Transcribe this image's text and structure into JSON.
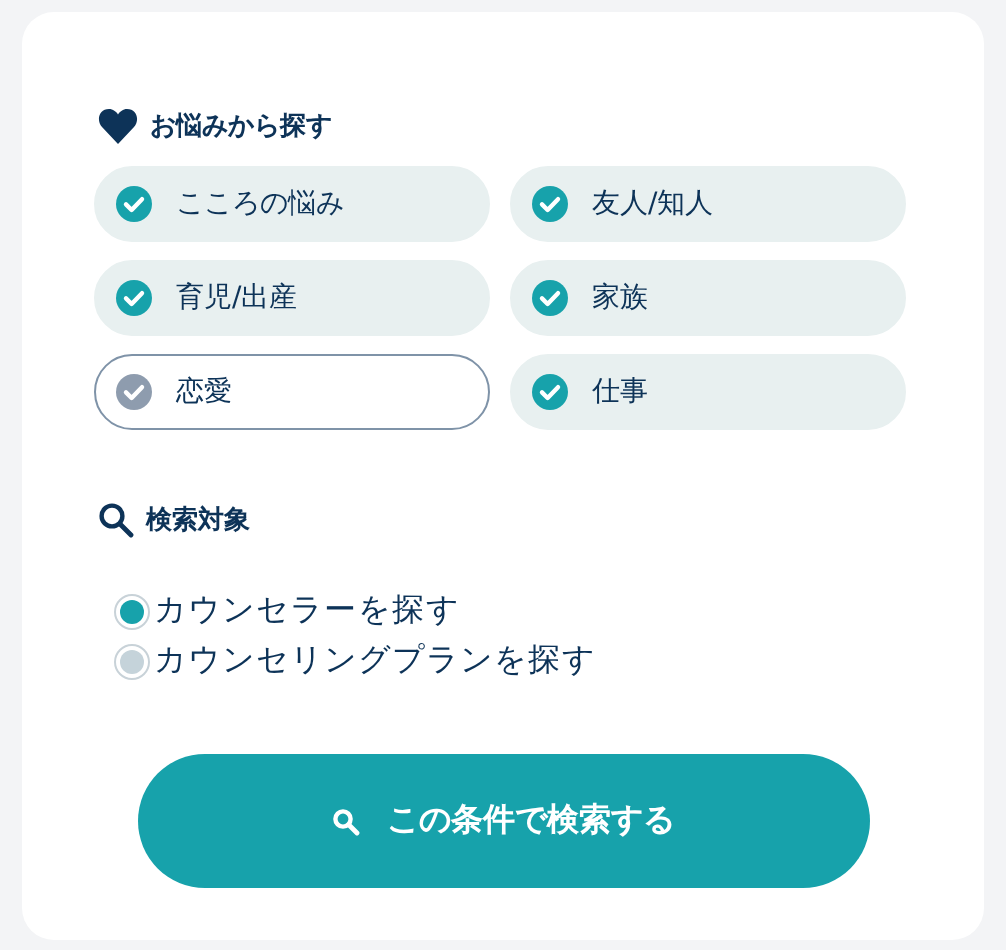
{
  "worries": {
    "heading": "お悩みから探す",
    "chips": [
      {
        "label": "こころの悩み",
        "checked": true
      },
      {
        "label": "友人/知人",
        "checked": true
      },
      {
        "label": "育児/出産",
        "checked": true
      },
      {
        "label": "家族",
        "checked": true
      },
      {
        "label": "恋愛",
        "checked": false
      },
      {
        "label": "仕事",
        "checked": true
      }
    ]
  },
  "target": {
    "heading": "検索対象",
    "options": [
      {
        "label": "カウンセラーを探す",
        "selected": true
      },
      {
        "label": "カウンセリングプランを探す",
        "selected": false
      }
    ]
  },
  "search_button": "この条件で検索する"
}
